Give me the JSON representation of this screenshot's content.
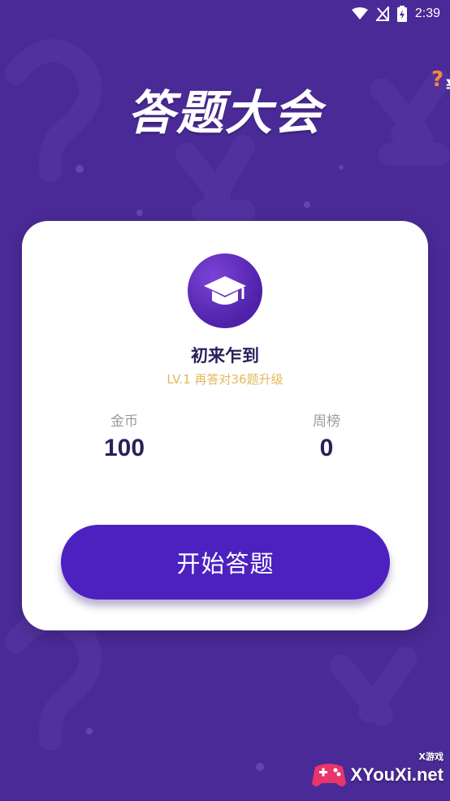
{
  "status_bar": {
    "time": "2:39",
    "icons": [
      "wifi-icon",
      "no-signal-icon",
      "battery-icon"
    ]
  },
  "logo": {
    "text": "答题大会",
    "deco_text": "?¥!"
  },
  "profile": {
    "avatar_icon": "graduation-cap-icon",
    "title": "初来乍到",
    "level": "LV.1 再答对36题升级"
  },
  "stats": {
    "coins_label": "金币",
    "coins_value": "100",
    "weekly_label": "周榜",
    "weekly_value": "0"
  },
  "start_button": {
    "label": "开始答题"
  },
  "watermark": {
    "text": "XYouXi.net",
    "sub": "X游戏"
  },
  "colors": {
    "background": "#4a2a96",
    "button": "#4c21c0",
    "accent_gold": "#e3b85a",
    "title_text": "#2b1f5a"
  }
}
